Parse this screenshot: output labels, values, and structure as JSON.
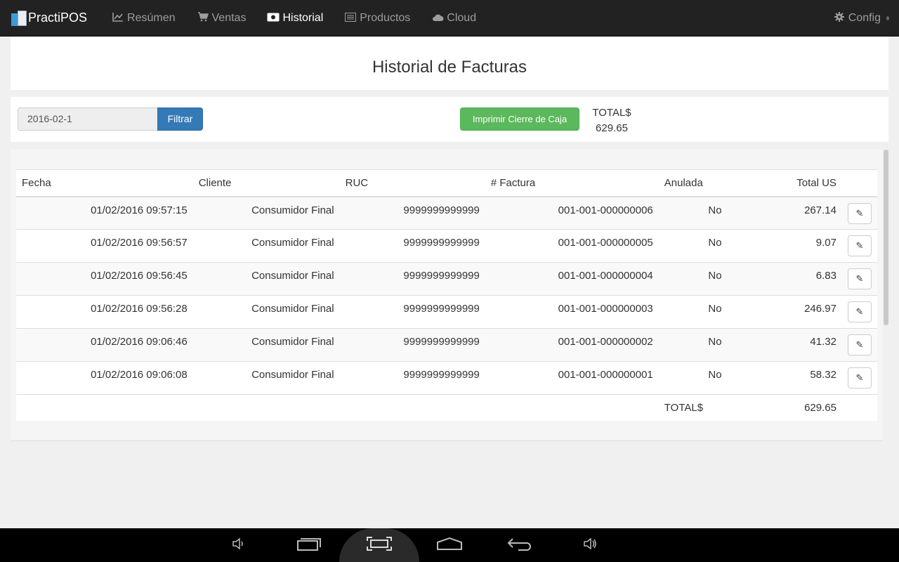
{
  "navbar": {
    "brand": "PractiPOS",
    "items": [
      {
        "label": "Resúmen",
        "icon": "line-chart-icon"
      },
      {
        "label": "Ventas",
        "icon": "shopping-cart-icon"
      },
      {
        "label": "Historial",
        "icon": "money-icon",
        "active": true
      },
      {
        "label": "Productos",
        "icon": "list-icon"
      },
      {
        "label": "Cloud",
        "icon": "cloud-icon"
      }
    ],
    "config": {
      "label": "Config",
      "icon": "gear-icon"
    }
  },
  "page": {
    "title": "Historial de Facturas"
  },
  "filter": {
    "date_value": "2016-02-1",
    "filter_label": "Filtrar",
    "print_label": "Imprimir Cierre de Caja",
    "total_label": "TOTAL$",
    "total_value": "629.65"
  },
  "table": {
    "headers": [
      "Fecha",
      "Cliente",
      "RUC",
      "# Factura",
      "Anulada",
      "Total US"
    ],
    "rows": [
      {
        "fecha": "01/02/2016 09:57:15",
        "cliente": "Consumidor Final",
        "ruc": "9999999999999",
        "factura": "001-001-000000006",
        "anulada": "No",
        "total": "267.14"
      },
      {
        "fecha": "01/02/2016 09:56:57",
        "cliente": "Consumidor Final",
        "ruc": "9999999999999",
        "factura": "001-001-000000005",
        "anulada": "No",
        "total": "9.07"
      },
      {
        "fecha": "01/02/2016 09:56:45",
        "cliente": "Consumidor Final",
        "ruc": "9999999999999",
        "factura": "001-001-000000004",
        "anulada": "No",
        "total": "6.83"
      },
      {
        "fecha": "01/02/2016 09:56:28",
        "cliente": "Consumidor Final",
        "ruc": "9999999999999",
        "factura": "001-001-000000003",
        "anulada": "No",
        "total": "246.97"
      },
      {
        "fecha": "01/02/2016 09:06:46",
        "cliente": "Consumidor Final",
        "ruc": "9999999999999",
        "factura": "001-001-000000002",
        "anulada": "No",
        "total": "41.32"
      },
      {
        "fecha": "01/02/2016 09:06:08",
        "cliente": "Consumidor Final",
        "ruc": "9999999999999",
        "factura": "001-001-000000001",
        "anulada": "No",
        "total": "58.32"
      }
    ],
    "footer_label": "TOTAL$",
    "footer_value": "629.65",
    "row_action_icon": "pencil-icon"
  },
  "android_bar": {
    "buttons": [
      "volume-down-icon",
      "recent-apps-icon",
      "screenshot-icon",
      "home-icon",
      "back-icon",
      "volume-up-icon"
    ]
  }
}
